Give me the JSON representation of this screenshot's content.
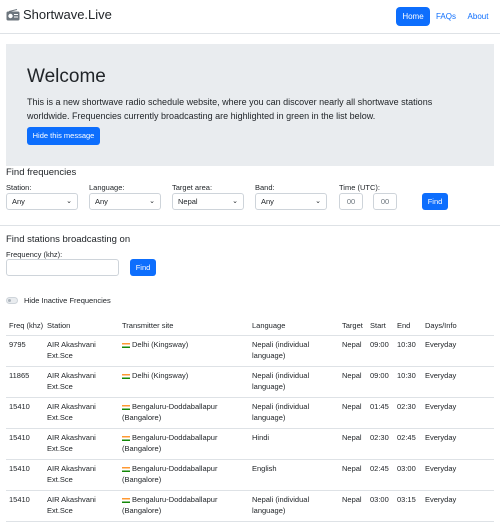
{
  "brand": {
    "title": "Shortwave.Live",
    "icon": "radio-icon"
  },
  "nav": {
    "home": "Home",
    "faqs": "FAQs",
    "about": "About"
  },
  "hero": {
    "heading": "Welcome",
    "text": "This is a new shortwave radio schedule website, where you can discover nearly all shortwave stations worldwide. Frequencies currently broadcasting are highlighted in green in the list below.",
    "hide_button": "Hide this message"
  },
  "find_freq": {
    "title": "Find frequencies",
    "station_label": "Station:",
    "station_value": "Any",
    "language_label": "Language:",
    "language_value": "Any",
    "target_label": "Target area:",
    "target_value": "Nepal",
    "band_label": "Band:",
    "band_value": "Any",
    "time_label": "Time (UTC):",
    "time_h_placeholder": "00",
    "time_m_placeholder": "00",
    "find_button": "Find"
  },
  "find_station": {
    "title": "Find stations broadcasting on",
    "freq_label": "Frequency (khz):",
    "find_button": "Find"
  },
  "toggle": {
    "label": "Hide Inactive Frequencies"
  },
  "table": {
    "headers": [
      "Freq (khz)",
      "Station",
      "Transmitter site",
      "Language",
      "Target",
      "Start",
      "End",
      "Days/Info"
    ],
    "rows": [
      [
        "9795",
        "AIR Akashvani Ext.Sce",
        "Delhi (Kingsway)",
        "Nepali (individual language)",
        "Nepal",
        "09:00",
        "10:30",
        "Everyday"
      ],
      [
        "11865",
        "AIR Akashvani Ext.Sce",
        "Delhi (Kingsway)",
        "Nepali (individual language)",
        "Nepal",
        "09:00",
        "10:30",
        "Everyday"
      ],
      [
        "15410",
        "AIR Akashvani Ext.Sce",
        "Bengaluru-Doddaballapur (Bangalore)",
        "Nepali (individual language)",
        "Nepal",
        "01:45",
        "02:30",
        "Everyday"
      ],
      [
        "15410",
        "AIR Akashvani Ext.Sce",
        "Bengaluru-Doddaballapur (Bangalore)",
        "Hindi",
        "Nepal",
        "02:30",
        "02:45",
        "Everyday"
      ],
      [
        "15410",
        "AIR Akashvani Ext.Sce",
        "Bengaluru-Doddaballapur (Bangalore)",
        "English",
        "Nepal",
        "02:45",
        "03:00",
        "Everyday"
      ],
      [
        "15410",
        "AIR Akashvani Ext.Sce",
        "Bengaluru-Doddaballapur (Bangalore)",
        "Nepali (individual language)",
        "Nepal",
        "03:00",
        "03:15",
        "Everyday"
      ]
    ]
  },
  "colors": {
    "primary": "#0d6efd",
    "hero_bg": "#e9ecef",
    "border": "#dee2e6"
  }
}
